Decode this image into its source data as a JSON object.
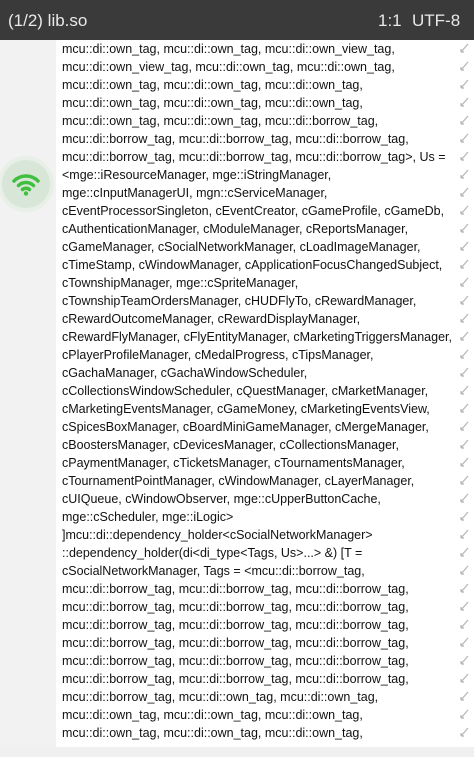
{
  "topbar": {
    "title": "(1/2) lib.so",
    "cursor": "1:1",
    "encoding": "UTF-8"
  },
  "colors": {
    "topbar_bg": "#3a3a3a",
    "wifi_green": "#3fbf3f",
    "wrap_icon": "#b5b5b5"
  },
  "fab": {
    "icon": "wifi-icon"
  },
  "lines": [
    "mcu::di::own_tag, mcu::di::own_tag, mcu::di::own_view_tag,",
    "mcu::di::own_view_tag, mcu::di::own_tag, mcu::di::own_tag,",
    "mcu::di::own_tag, mcu::di::own_tag, mcu::di::own_tag,",
    "mcu::di::own_tag, mcu::di::own_tag, mcu::di::own_tag,",
    "mcu::di::own_tag, mcu::di::own_tag, mcu::di::borrow_tag,",
    "mcu::di::borrow_tag, mcu::di::borrow_tag, mcu::di::borrow_tag,",
    "mcu::di::borrow_tag, mcu::di::borrow_tag, mcu::di::borrow_tag>, Us =",
    "<mge::iResourceManager, mge::iStringManager,",
    "mge::cInputManagerUI, mgn::cServiceManager,",
    "cEventProcessorSingleton, cEventCreator, cGameProfile, cGameDb,",
    "cAuthenticationManager, cModuleManager, cReportsManager,",
    "cGameManager, cSocialNetworkManager, cLoadImageManager,",
    "cTimeStamp, cWindowManager, cApplicationFocusChangedSubject,",
    "cTownshipManager, mge::cSpriteManager,",
    "cTownshipTeamOrdersManager, cHUDFlyTo, cRewardManager,",
    "cRewardOutcomeManager, cRewardDisplayManager,",
    "cRewardFlyManager, cFlyEntityManager, cMarketingTriggersManager,",
    " cPlayerProfileManager, cMedalProgress, cTipsManager,",
    "cGachaManager, cGachaWindowScheduler,",
    "cCollectionsWindowScheduler, cQuestManager, cMarketManager,",
    "cMarketingEventsManager, cGameMoney, cMarketingEventsView,",
    "cSpicesBoxManager, cBoardMiniGameManager, cMergeManager,",
    "cBoostersManager, cDevicesManager, cCollectionsManager,",
    "cPaymentManager, cTicketsManager, cTournamentsManager,",
    "cTournamentPointManager, cWindowManager, cLayerManager,",
    "cUIQueue, cWindowObserver, mge::cUpperButtonCache,",
    "mge::cScheduler, mge::iLogic>",
    "]mcu::di::dependency_holder<cSocialNetworkManager>",
    "::dependency_holder(di<di_type<Tags, Us>...> &) [T =",
    "cSocialNetworkManager, Tags = <mcu::di::borrow_tag,",
    "mcu::di::borrow_tag, mcu::di::borrow_tag, mcu::di::borrow_tag,",
    "mcu::di::borrow_tag, mcu::di::borrow_tag, mcu::di::borrow_tag,",
    "mcu::di::borrow_tag, mcu::di::borrow_tag, mcu::di::borrow_tag,",
    "mcu::di::borrow_tag, mcu::di::borrow_tag, mcu::di::borrow_tag,",
    "mcu::di::borrow_tag, mcu::di::borrow_tag, mcu::di::borrow_tag,",
    "mcu::di::borrow_tag, mcu::di::borrow_tag, mcu::di::borrow_tag,",
    "mcu::di::borrow_tag, mcu::di::own_tag, mcu::di::own_tag,",
    "mcu::di::own_tag, mcu::di::own_tag, mcu::di::own_tag,",
    "mcu::di::own_tag, mcu::di::own_tag, mcu::di::own_tag,"
  ]
}
